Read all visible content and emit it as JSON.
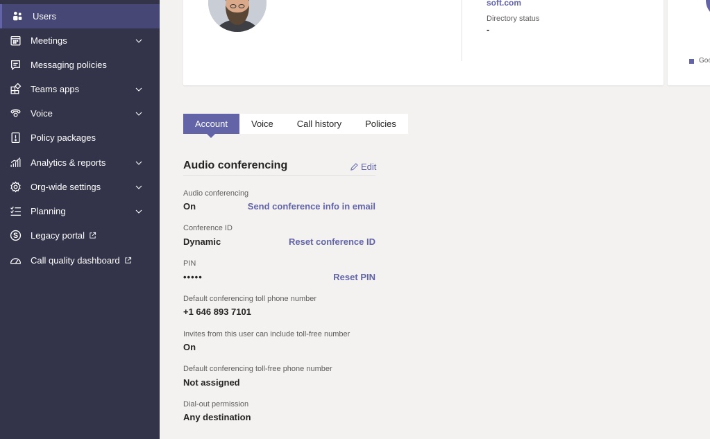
{
  "sidebar": {
    "items": [
      {
        "label": "Users",
        "icon": "users-icon"
      },
      {
        "label": "Meetings",
        "icon": "calendar-icon"
      },
      {
        "label": "Messaging policies",
        "icon": "message-icon"
      },
      {
        "label": "Teams apps",
        "icon": "apps-icon"
      },
      {
        "label": "Voice",
        "icon": "phone-icon"
      },
      {
        "label": "Policy packages",
        "icon": "policy-package-icon"
      },
      {
        "label": "Analytics & reports",
        "icon": "analytics-icon"
      },
      {
        "label": "Org-wide settings",
        "icon": "settings-gear-icon"
      },
      {
        "label": "Planning",
        "icon": "checklist-icon"
      },
      {
        "label": "Legacy portal",
        "icon": "skype-icon"
      },
      {
        "label": "Call quality dashboard",
        "icon": "gauge-icon"
      }
    ],
    "colors": {
      "background": "#33344a",
      "active": "#464775",
      "accent": "#6264a7"
    }
  },
  "profile": {
    "email_fragment": "soft.com",
    "directory_status_label": "Directory status",
    "directory_status_value": "-",
    "legend_fragment": "Goo"
  },
  "tabs": [
    {
      "label": "Account",
      "active": true
    },
    {
      "label": "Voice"
    },
    {
      "label": "Call history"
    },
    {
      "label": "Policies"
    }
  ],
  "audio": {
    "title": "Audio conferencing",
    "edit_label": "Edit",
    "fields": [
      {
        "label": "Audio conferencing",
        "value": "On",
        "action": "Send conference info in email"
      },
      {
        "label": "Conference ID",
        "value": "Dynamic",
        "action": "Reset conference ID"
      },
      {
        "label": "PIN",
        "value": "•••••",
        "action": "Reset PIN"
      },
      {
        "label": "Default conferencing toll phone number",
        "value": "+1 646 893 7101"
      },
      {
        "label": "Invites from this user can include toll-free number",
        "value": "On"
      },
      {
        "label": "Default conferencing toll-free phone number",
        "value": "Not assigned"
      },
      {
        "label": "Dial-out permission",
        "value": "Any destination"
      }
    ]
  }
}
